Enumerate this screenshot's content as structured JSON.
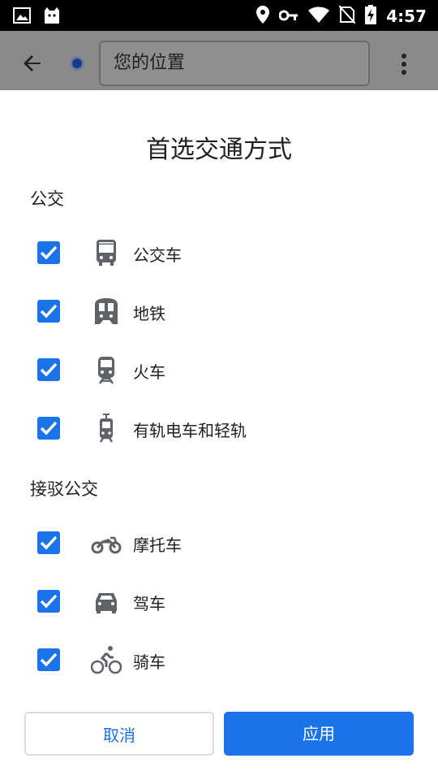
{
  "status_bar": {
    "time": "4:57",
    "icons": [
      "image-icon",
      "cat-icon",
      "location-icon",
      "key-icon",
      "wifi-icon",
      "no-sim-icon",
      "battery-charging-icon"
    ]
  },
  "header": {
    "location_text": "您的位置"
  },
  "sheet": {
    "title": "首选交通方式",
    "sections": [
      {
        "label": "公交",
        "items": [
          {
            "label": "公交车",
            "icon": "bus-icon",
            "checked": true
          },
          {
            "label": "地铁",
            "icon": "subway-icon",
            "checked": true
          },
          {
            "label": "火车",
            "icon": "train-icon",
            "checked": true
          },
          {
            "label": "有轨电车和轻轨",
            "icon": "tram-icon",
            "checked": true
          }
        ]
      },
      {
        "label": "接驳公交",
        "items": [
          {
            "label": "摩托车",
            "icon": "motorcycle-icon",
            "checked": true
          },
          {
            "label": "驾车",
            "icon": "car-icon",
            "checked": true
          },
          {
            "label": "骑车",
            "icon": "bicycle-icon",
            "checked": true
          }
        ]
      }
    ],
    "cancel_label": "取消",
    "apply_label": "应用"
  },
  "colors": {
    "accent": "#1a73e8",
    "icon": "#5f6368"
  }
}
